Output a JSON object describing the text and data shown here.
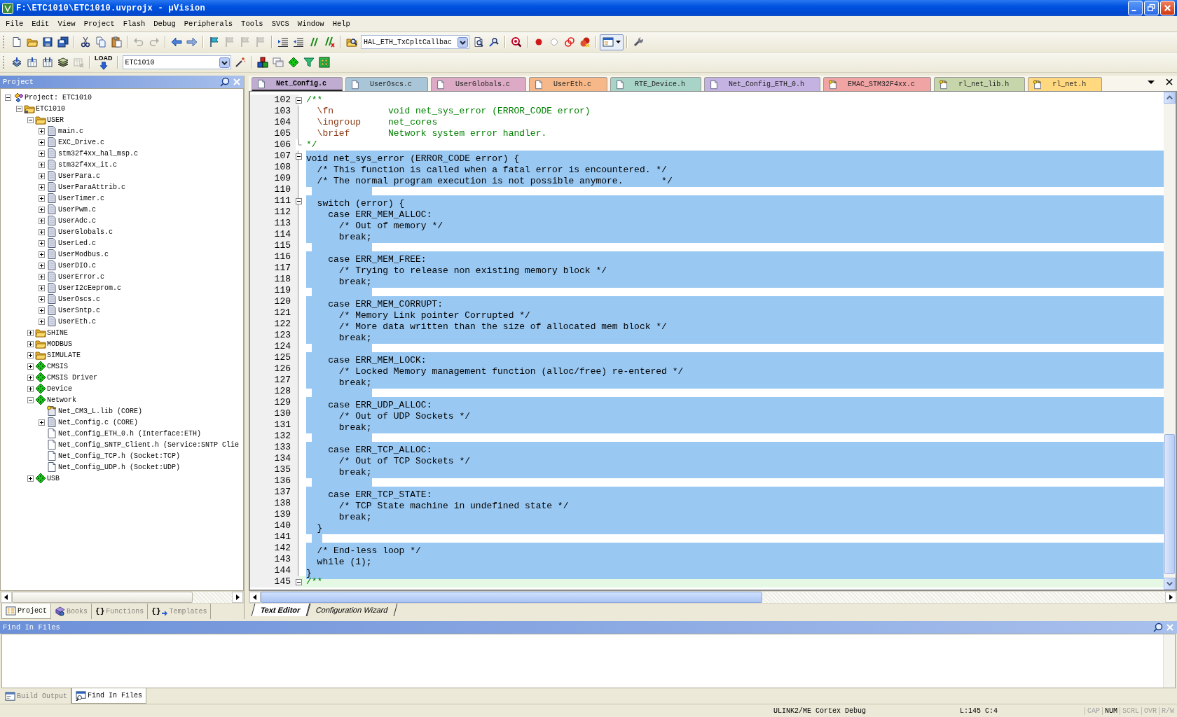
{
  "window": {
    "title": "F:\\ETC1010\\ETC1010.uvprojx - µVision"
  },
  "menu": [
    "File",
    "Edit",
    "View",
    "Project",
    "Flash",
    "Debug",
    "Peripherals",
    "Tools",
    "SVCS",
    "Window",
    "Help"
  ],
  "toolbar_1": [
    {
      "items": [
        {
          "kind": "button",
          "disabled": false
        },
        {
          "kind": "button",
          "disabled": false
        },
        {
          "kind": "button",
          "disabled": false
        },
        {
          "kind": "button",
          "disabled": false
        }
      ]
    },
    {
      "items": [
        {
          "kind": "button",
          "disabled": false
        },
        {
          "kind": "button",
          "disabled": false
        },
        {
          "kind": "button",
          "disabled": false
        }
      ]
    },
    {
      "items": [
        {
          "kind": "button",
          "disabled": true
        },
        {
          "kind": "button",
          "disabled": true
        }
      ]
    },
    {
      "items": [
        {
          "kind": "button",
          "disabled": false
        },
        {
          "kind": "button",
          "disabled": false
        }
      ]
    },
    {
      "items": [
        {
          "kind": "button",
          "disabled": false
        },
        {
          "kind": "button",
          "disabled": true
        },
        {
          "kind": "button",
          "disabled": true
        },
        {
          "kind": "button",
          "disabled": true
        }
      ]
    },
    {
      "items": [
        {
          "kind": "button",
          "disabled": false
        },
        {
          "kind": "button",
          "disabled": false
        },
        {
          "kind": "button",
          "disabled": false
        },
        {
          "kind": "button",
          "disabled": false
        }
      ]
    },
    {
      "items": [
        {
          "kind": "button",
          "disabled": false
        },
        {
          "kind": "combo",
          "value": "HAL_ETH_TxCpltCallbac"
        },
        {
          "kind": "button",
          "disabled": false
        },
        {
          "kind": "button",
          "disabled": false
        }
      ]
    },
    {
      "items": [
        {
          "kind": "button",
          "disabled": false
        }
      ]
    },
    {
      "items": [
        {
          "kind": "button",
          "disabled": false
        },
        {
          "kind": "button",
          "disabled": false
        },
        {
          "kind": "button",
          "disabled": false
        },
        {
          "kind": "button",
          "disabled": false
        }
      ]
    },
    {
      "items": [
        {
          "kind": "menubutton",
          "disabled": false
        }
      ]
    },
    {
      "items": [
        {
          "kind": "button",
          "disabled": false
        }
      ]
    }
  ],
  "toolbar_2": [
    {
      "items": [
        {
          "kind": "button",
          "disabled": false
        },
        {
          "kind": "button",
          "disabled": false
        },
        {
          "kind": "button",
          "disabled": false
        },
        {
          "kind": "button",
          "disabled": false
        },
        {
          "kind": "button",
          "disabled": true
        }
      ]
    },
    {
      "items": [
        {
          "kind": "button",
          "label": "LOAD",
          "disabled": false
        }
      ]
    },
    {
      "items": [
        {
          "kind": "combo",
          "value": "ETC1010"
        },
        {
          "kind": "button",
          "disabled": false
        }
      ]
    },
    {
      "items": [
        {
          "kind": "button",
          "disabled": false
        },
        {
          "kind": "button",
          "disabled": false
        },
        {
          "kind": "button",
          "disabled": false
        },
        {
          "kind": "button",
          "disabled": false
        },
        {
          "kind": "button",
          "disabled": false
        }
      ]
    }
  ],
  "project_panel": {
    "title": "Project",
    "tree": [
      {
        "label": "Project: ETC1010",
        "kind": "project",
        "expanded": true,
        "children": [
          {
            "label": "ETC1010",
            "kind": "target",
            "expanded": true,
            "children": [
              {
                "label": "USER",
                "kind": "folder",
                "expanded": true,
                "children": [
                  {
                    "label": "main.c",
                    "kind": "file",
                    "expanded": false
                  },
                  {
                    "label": "EXC_Drive.c",
                    "kind": "file",
                    "expanded": false
                  },
                  {
                    "label": "stm32f4xx_hal_msp.c",
                    "kind": "file",
                    "expanded": false
                  },
                  {
                    "label": "stm32f4xx_it.c",
                    "kind": "file",
                    "expanded": false
                  },
                  {
                    "label": "UserPara.c",
                    "kind": "file",
                    "expanded": false
                  },
                  {
                    "label": "UserParaAttrib.c",
                    "kind": "file",
                    "expanded": false
                  },
                  {
                    "label": "UserTimer.c",
                    "kind": "file",
                    "expanded": false
                  },
                  {
                    "label": "UserPwm.c",
                    "kind": "file",
                    "expanded": false
                  },
                  {
                    "label": "UserAdc.c",
                    "kind": "file",
                    "expanded": false
                  },
                  {
                    "label": "UserGlobals.c",
                    "kind": "file",
                    "expanded": false
                  },
                  {
                    "label": "UserLed.c",
                    "kind": "file",
                    "expanded": false
                  },
                  {
                    "label": "UserModbus.c",
                    "kind": "file",
                    "expanded": false
                  },
                  {
                    "label": "UserDIO.c",
                    "kind": "file",
                    "expanded": false
                  },
                  {
                    "label": "UserError.c",
                    "kind": "file",
                    "expanded": false
                  },
                  {
                    "label": "UserI2cEeprom.c",
                    "kind": "file",
                    "expanded": false
                  },
                  {
                    "label": "UserOscs.c",
                    "kind": "file",
                    "expanded": false
                  },
                  {
                    "label": "UserSntp.c",
                    "kind": "file",
                    "expanded": false
                  },
                  {
                    "label": "UserEth.c",
                    "kind": "file",
                    "expanded": false
                  }
                ]
              },
              {
                "label": "SHINE",
                "kind": "folder",
                "expanded": false
              },
              {
                "label": "MODBUS",
                "kind": "folder",
                "expanded": false
              },
              {
                "label": "SIMULATE",
                "kind": "folder",
                "expanded": false
              },
              {
                "label": "CMSIS",
                "kind": "component",
                "expanded": false
              },
              {
                "label": "CMSIS Driver",
                "kind": "component",
                "expanded": false
              },
              {
                "label": "Device",
                "kind": "component",
                "expanded": false
              },
              {
                "label": "Network",
                "kind": "component",
                "expanded": true,
                "children": [
                  {
                    "label": "Net_CM3_L.lib (CORE)",
                    "kind": "lib"
                  },
                  {
                    "label": "Net_Config.c (CORE)",
                    "kind": "file",
                    "expanded": false
                  },
                  {
                    "label": "Net_Config_ETH_0.h (Interface:ETH)",
                    "kind": "header"
                  },
                  {
                    "label": "Net_Config_SNTP_Client.h (Service:SNTP Clie",
                    "kind": "header"
                  },
                  {
                    "label": "Net_Config_TCP.h (Socket:TCP)",
                    "kind": "header"
                  },
                  {
                    "label": "Net_Config_UDP.h (Socket:UDP)",
                    "kind": "header"
                  }
                ]
              },
              {
                "label": "USB",
                "kind": "component",
                "expanded": false
              }
            ]
          }
        ]
      }
    ],
    "tabs": [
      {
        "label": "Project",
        "kind": "tree",
        "selected": true
      },
      {
        "label": "Books",
        "kind": "books",
        "selected": false
      },
      {
        "label": "Functions",
        "kind": "braces",
        "glyph": "{}",
        "selected": false
      },
      {
        "label": "Templates",
        "kind": "braces-arrow",
        "glyph": "{}",
        "selected": false
      }
    ]
  },
  "file_tabs": [
    {
      "label": "Net_Config.c",
      "kind": "file",
      "color": "#c0acd0",
      "selected": true
    },
    {
      "label": "UserOscs.c",
      "kind": "file",
      "color": "#a9c6d8",
      "selected": false
    },
    {
      "label": "UserGlobals.c",
      "kind": "file",
      "color": "#dcaac4",
      "selected": false
    },
    {
      "label": "UserEth.c",
      "kind": "file",
      "color": "#f6b888",
      "selected": false
    },
    {
      "label": "RTE_Device.h",
      "kind": "file",
      "color": "#a8d4c8",
      "selected": false
    },
    {
      "label": "Net_Config_ETH_0.h",
      "kind": "file",
      "color": "#c4b2e2",
      "selected": false
    },
    {
      "label": "EMAC_STM32F4xx.c",
      "kind": "key",
      "color": "#f0a4a4",
      "selected": false
    },
    {
      "label": "rl_net_lib.h",
      "kind": "key",
      "color": "#c6d6aa",
      "selected": false
    },
    {
      "label": "rl_net.h",
      "kind": "key",
      "color": "#ffd880",
      "selected": false
    }
  ],
  "editor": {
    "lines": [
      {
        "no": "102",
        "kind": "comment",
        "text": "/**",
        "fold_start": true,
        "fold_end": false,
        "selected": false,
        "current": false
      },
      {
        "no": "103",
        "kind": "doc",
        "tag": "\\fn",
        "text": "void net_sys_error (ERROR_CODE error)",
        "fold_start": false,
        "fold_end": false,
        "selected": false,
        "current": false
      },
      {
        "no": "104",
        "kind": "doc",
        "tag": "\\ingroup",
        "text": "net_cores",
        "fold_start": false,
        "fold_end": false,
        "selected": false,
        "current": false
      },
      {
        "no": "105",
        "kind": "doc",
        "tag": "\\brief",
        "text": "Network system error handler.",
        "fold_start": false,
        "fold_end": false,
        "selected": false,
        "current": false
      },
      {
        "no": "106",
        "kind": "comment",
        "text": "*/",
        "fold_start": false,
        "fold_end": true,
        "selected": false,
        "current": false
      },
      {
        "no": "107",
        "kind": "code",
        "text": "void net_sys_error (ERROR_CODE error) {",
        "fold_start": true,
        "fold_end": false,
        "selected": true,
        "current": false
      },
      {
        "no": "108",
        "kind": "code",
        "text": "  /* This function is called when a fatal error is encountered. */",
        "fold_start": false,
        "fold_end": false,
        "selected": true,
        "current": false
      },
      {
        "no": "109",
        "kind": "code",
        "text": "  /* The normal program execution is not possible anymore.       */",
        "fold_start": false,
        "fold_end": false,
        "selected": true,
        "current": false
      },
      {
        "no": "110",
        "kind": "code",
        "fold_start": false,
        "fold_end": false,
        "selected": true,
        "current": false
      },
      {
        "no": "111",
        "kind": "code",
        "text": "  switch (error) {",
        "fold_start": true,
        "fold_end": false,
        "selected": true,
        "current": false
      },
      {
        "no": "112",
        "kind": "code",
        "text": "    case ERR_MEM_ALLOC:",
        "fold_start": false,
        "fold_end": false,
        "selected": true,
        "current": false
      },
      {
        "no": "113",
        "kind": "code",
        "text": "      /* Out of memory */",
        "fold_start": false,
        "fold_end": false,
        "selected": true,
        "current": false
      },
      {
        "no": "114",
        "kind": "code",
        "text": "      break;",
        "fold_start": false,
        "fold_end": false,
        "selected": true,
        "current": false
      },
      {
        "no": "115",
        "kind": "code",
        "fold_start": false,
        "fold_end": false,
        "selected": true,
        "current": false
      },
      {
        "no": "116",
        "kind": "code",
        "text": "    case ERR_MEM_FREE:",
        "fold_start": false,
        "fold_end": false,
        "selected": true,
        "current": false
      },
      {
        "no": "117",
        "kind": "code",
        "text": "      /* Trying to release non existing memory block */",
        "fold_start": false,
        "fold_end": false,
        "selected": true,
        "current": false
      },
      {
        "no": "118",
        "kind": "code",
        "text": "      break;",
        "fold_start": false,
        "fold_end": false,
        "selected": true,
        "current": false
      },
      {
        "no": "119",
        "kind": "code",
        "fold_start": false,
        "fold_end": false,
        "selected": true,
        "current": false
      },
      {
        "no": "120",
        "kind": "code",
        "text": "    case ERR_MEM_CORRUPT:",
        "fold_start": false,
        "fold_end": false,
        "selected": true,
        "current": false
      },
      {
        "no": "121",
        "kind": "code",
        "text": "      /* Memory Link pointer Corrupted */",
        "fold_start": false,
        "fold_end": false,
        "selected": true,
        "current": false
      },
      {
        "no": "122",
        "kind": "code",
        "text": "      /* More data written than the size of allocated mem block */",
        "fold_start": false,
        "fold_end": false,
        "selected": true,
        "current": false
      },
      {
        "no": "123",
        "kind": "code",
        "text": "      break;",
        "fold_start": false,
        "fold_end": false,
        "selected": true,
        "current": false
      },
      {
        "no": "124",
        "kind": "code",
        "fold_start": false,
        "fold_end": false,
        "selected": true,
        "current": false
      },
      {
        "no": "125",
        "kind": "code",
        "text": "    case ERR_MEM_LOCK:",
        "fold_start": false,
        "fold_end": false,
        "selected": true,
        "current": false
      },
      {
        "no": "126",
        "kind": "code",
        "text": "      /* Locked Memory management function (alloc/free) re-entered */",
        "fold_start": false,
        "fold_end": false,
        "selected": true,
        "current": false
      },
      {
        "no": "127",
        "kind": "code",
        "text": "      break;",
        "fold_start": false,
        "fold_end": false,
        "selected": true,
        "current": false
      },
      {
        "no": "128",
        "kind": "code",
        "fold_start": false,
        "fold_end": false,
        "selected": true,
        "current": false
      },
      {
        "no": "129",
        "kind": "code",
        "text": "    case ERR_UDP_ALLOC:",
        "fold_start": false,
        "fold_end": false,
        "selected": true,
        "current": false
      },
      {
        "no": "130",
        "kind": "code",
        "text": "      /* Out of UDP Sockets */",
        "fold_start": false,
        "fold_end": false,
        "selected": true,
        "current": false
      },
      {
        "no": "131",
        "kind": "code",
        "text": "      break;",
        "fold_start": false,
        "fold_end": false,
        "selected": true,
        "current": false
      },
      {
        "no": "132",
        "kind": "code",
        "fold_start": false,
        "fold_end": false,
        "selected": true,
        "current": false
      },
      {
        "no": "133",
        "kind": "code",
        "text": "    case ERR_TCP_ALLOC:",
        "fold_start": false,
        "fold_end": false,
        "selected": true,
        "current": false
      },
      {
        "no": "134",
        "kind": "code",
        "text": "      /* Out of TCP Sockets */",
        "fold_start": false,
        "fold_end": false,
        "selected": true,
        "current": false
      },
      {
        "no": "135",
        "kind": "code",
        "text": "      break;",
        "fold_start": false,
        "fold_end": false,
        "selected": true,
        "current": false
      },
      {
        "no": "136",
        "kind": "code",
        "fold_start": false,
        "fold_end": false,
        "selected": true,
        "current": false
      },
      {
        "no": "137",
        "kind": "code",
        "text": "    case ERR_TCP_STATE:",
        "fold_start": false,
        "fold_end": false,
        "selected": true,
        "current": false
      },
      {
        "no": "138",
        "kind": "code",
        "text": "      /* TCP State machine in undefined state */",
        "fold_start": false,
        "fold_end": false,
        "selected": true,
        "current": false
      },
      {
        "no": "139",
        "kind": "code",
        "text": "      break;",
        "fold_start": false,
        "fold_end": false,
        "selected": true,
        "current": false
      },
      {
        "no": "140",
        "kind": "code",
        "text": "  }",
        "fold_start": false,
        "fold_end": false,
        "selected": true,
        "current": false
      },
      {
        "no": "141",
        "kind": "code",
        "fold_start": false,
        "fold_end": false,
        "selected": true,
        "current": false
      },
      {
        "no": "142",
        "kind": "code",
        "text": "  /* End-less loop */",
        "fold_start": false,
        "fold_end": false,
        "selected": true,
        "current": false
      },
      {
        "no": "143",
        "kind": "code",
        "text": "  while (1);",
        "fold_start": false,
        "fold_end": false,
        "selected": true,
        "current": false
      },
      {
        "no": "144",
        "kind": "code",
        "text": "}",
        "fold_start": false,
        "fold_end": false,
        "selected": true,
        "current": false
      },
      {
        "no": "145",
        "kind": "comment",
        "text": "/**",
        "fold_start": true,
        "fold_end": false,
        "selected": false,
        "current": true
      }
    ],
    "tabs": [
      {
        "label": "Text Editor",
        "selected": true
      },
      {
        "label": "Configuration Wizard",
        "selected": false
      }
    ]
  },
  "output_panel": {
    "title": "Find In Files",
    "tabs": [
      {
        "label": "Build Output",
        "selected": false
      },
      {
        "label": "Find In Files",
        "selected": true
      }
    ]
  },
  "status_bar": {
    "target": "ULINK2/ME Cortex Debug",
    "position": "L:145 C:4",
    "indicators": [
      {
        "label": "CAP",
        "on": false
      },
      {
        "label": "NUM",
        "on": true
      },
      {
        "label": "SCRL",
        "on": false
      },
      {
        "label": "OVR",
        "on": false
      },
      {
        "label": "R/W",
        "on": false
      }
    ]
  }
}
